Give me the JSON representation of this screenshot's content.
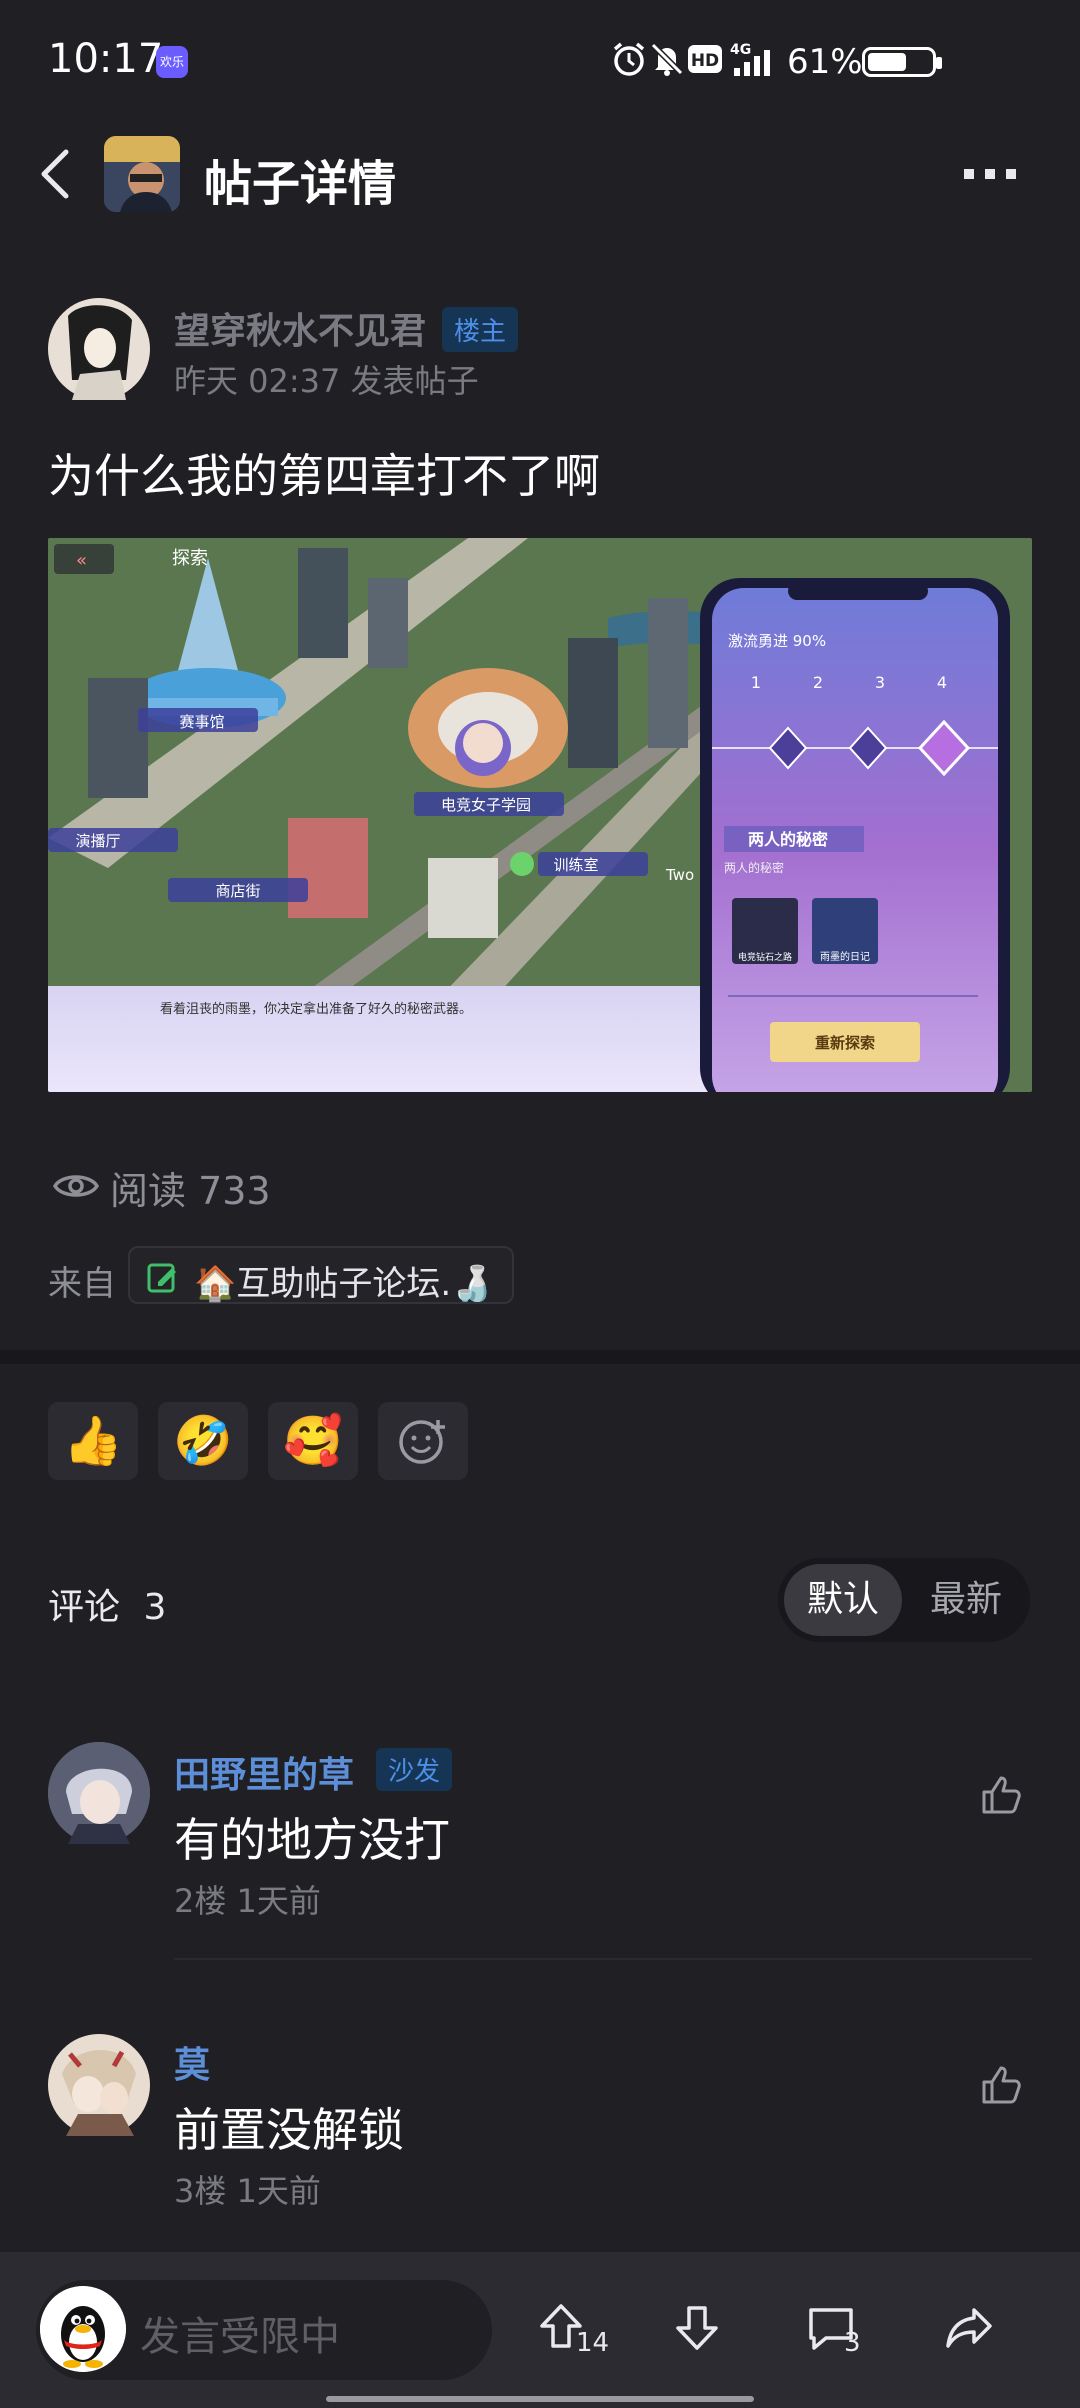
{
  "status_bar": {
    "time": "10:17",
    "app_badge": "欢乐",
    "battery": "61%",
    "icons": [
      "alarm-icon",
      "mute-icon",
      "hd-icon",
      "signal-4g-icon",
      "battery-icon"
    ]
  },
  "header": {
    "title": "帖子详情",
    "back_icon": "back-icon",
    "more_icon": "more-icon"
  },
  "post": {
    "author": "望穿秋水不见君",
    "author_badge": "楼主",
    "time": "昨天 02:37 发表帖子",
    "title": "为什么我的第四章打不了啊",
    "image": {
      "explore_label": "探索",
      "places": [
        "赛事馆",
        "演播厅",
        "商店街",
        "电竞女子学园",
        "训练室",
        "Two"
      ],
      "caption": "看着沮丧的雨墨，你决定拿出准备了好久的秘密武器。",
      "phone_title": "激流勇进 90%",
      "chapters": [
        "1",
        "2",
        "3",
        "4"
      ],
      "secret_title": "两人的秘密",
      "secret_sub": "两人的秘密",
      "cards": [
        "电竞钻石之路",
        "雨墨的日记"
      ],
      "re_explore": "重新探索"
    },
    "reads": "阅读 733",
    "from_label": "来自",
    "forum": "🏠互助帖子论坛.🍶"
  },
  "reactions": [
    "👍",
    "🤣",
    "🥰",
    "add-reaction-icon"
  ],
  "comments": {
    "label": "评论",
    "count": "3",
    "sort_default": "默认",
    "sort_latest": "最新",
    "items": [
      {
        "name": "田野里的草",
        "badge": "沙发",
        "text": "有的地方没打",
        "meta": "2楼 1天前"
      },
      {
        "name": "莫",
        "badge": "",
        "text": "前置没解锁",
        "meta": "3楼 1天前"
      }
    ]
  },
  "bottom_bar": {
    "placeholder": "发言受限中",
    "upvotes": "14",
    "comments": "3"
  }
}
